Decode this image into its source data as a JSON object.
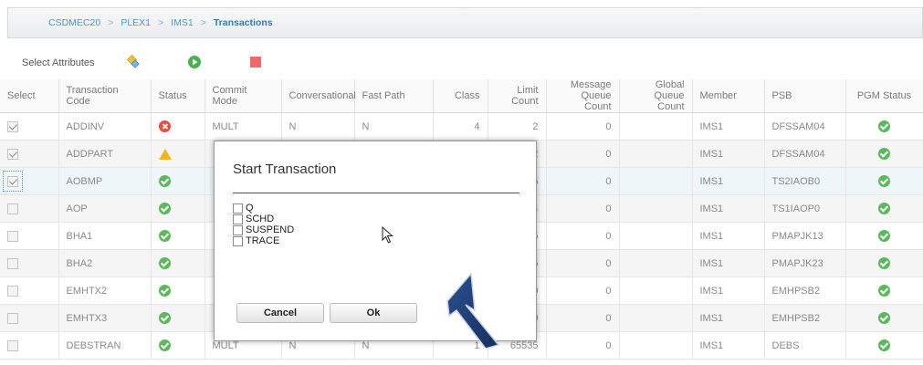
{
  "breadcrumb": {
    "items": [
      "CSDMEC20",
      "PLEX1",
      "IMS1"
    ],
    "separator": ">",
    "current": "Transactions"
  },
  "toolbar": {
    "select_attributes_label": "Select Attributes",
    "icons": [
      "attributes-icon",
      "start-icon",
      "stop-icon"
    ]
  },
  "table": {
    "columns": [
      "Select",
      "Transaction Code",
      "Status",
      "Commit Mode",
      "Conversational",
      "Fast Path",
      "Class",
      "Limit Count",
      "Message Queue Count",
      "Global Queue Count",
      "Member",
      "PSB",
      "PGM Status"
    ],
    "rows": [
      {
        "checked": true,
        "code": "ADDINV",
        "status": "error",
        "commit": "MULT",
        "conv": "N",
        "fast": "N",
        "cls": "4",
        "limit": "2",
        "mqc": "0",
        "gqc": "",
        "member": "IMS1",
        "psb": "DFSSAM04",
        "pgm": "ok"
      },
      {
        "checked": true,
        "code": "ADDPART",
        "status": "warning",
        "commit": "",
        "conv": "",
        "fast": "",
        "cls": "",
        "limit": "2",
        "mqc": "0",
        "gqc": "",
        "member": "IMS1",
        "psb": "DFSSAM04",
        "pgm": "ok"
      },
      {
        "checked": true,
        "code": "AOBMP",
        "status": "ok",
        "commit": "",
        "conv": "",
        "fast": "",
        "cls": "",
        "limit": "65535",
        "mqc": "0",
        "gqc": "",
        "member": "IMS1",
        "psb": "TS2IAOB0",
        "pgm": "ok"
      },
      {
        "checked": false,
        "code": "AOP",
        "status": "ok",
        "commit": "",
        "conv": "",
        "fast": "",
        "cls": "",
        "limit": "4",
        "mqc": "0",
        "gqc": "",
        "member": "IMS1",
        "psb": "TS1IAOP0",
        "pgm": "ok"
      },
      {
        "checked": false,
        "code": "BHA1",
        "status": "ok",
        "commit": "",
        "conv": "",
        "fast": "",
        "cls": "",
        "limit": "65535",
        "mqc": "0",
        "gqc": "",
        "member": "IMS1",
        "psb": "PMAPJK13",
        "pgm": "ok"
      },
      {
        "checked": false,
        "code": "BHA2",
        "status": "ok",
        "commit": "",
        "conv": "",
        "fast": "",
        "cls": "",
        "limit": "65535",
        "mqc": "0",
        "gqc": "",
        "member": "IMS1",
        "psb": "PMAPJK23",
        "pgm": "ok"
      },
      {
        "checked": false,
        "code": "EMHTX2",
        "status": "ok",
        "commit": "",
        "conv": "",
        "fast": "",
        "cls": "",
        "limit": "0",
        "mqc": "0",
        "gqc": "",
        "member": "IMS1",
        "psb": "EMHPSB2",
        "pgm": "ok"
      },
      {
        "checked": false,
        "code": "EMHTX3",
        "status": "ok",
        "commit": "",
        "conv": "",
        "fast": "",
        "cls": "",
        "limit": "0",
        "mqc": "0",
        "gqc": "",
        "member": "IMS1",
        "psb": "EMHPSB2",
        "pgm": "ok"
      },
      {
        "checked": false,
        "code": "DEBSTRAN",
        "status": "ok",
        "commit": "MULT",
        "conv": "N",
        "fast": "N",
        "cls": "1",
        "limit": "65535",
        "mqc": "0",
        "gqc": "",
        "member": "IMS1",
        "psb": "DEBS",
        "pgm": "ok"
      }
    ]
  },
  "dialog": {
    "title": "Start Transaction",
    "options": [
      "Q",
      "SCHD",
      "SUSPEND",
      "TRACE"
    ],
    "cancel_label": "Cancel",
    "ok_label": "Ok"
  },
  "colors": {
    "accent": "#2f7fb4",
    "status_ok": "#5cb85c",
    "status_error": "#e74c3c",
    "status_warning": "#f0b429",
    "stop": "#f06a6a",
    "arrow": "#1f3f7a"
  }
}
